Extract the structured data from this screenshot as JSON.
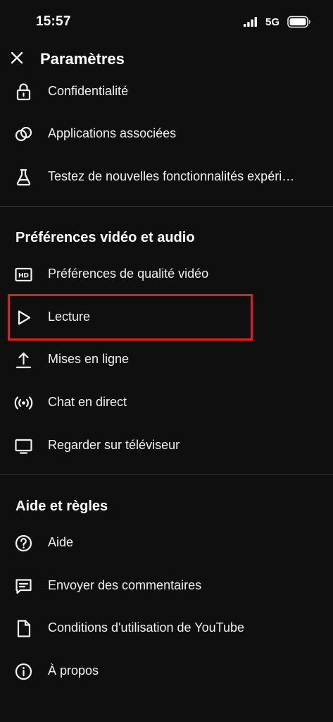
{
  "status_bar": {
    "time": "15:57",
    "network": "5G"
  },
  "header": {
    "title": "Paramètres"
  },
  "top_items": [
    {
      "label": "Confidentialité",
      "icon": "lock-icon"
    },
    {
      "label": "Applications associées",
      "icon": "linked-circles-icon"
    },
    {
      "label": "Testez de nouvelles fonctionnalités expéri…",
      "icon": "flask-icon"
    }
  ],
  "video_audio": {
    "title": "Préférences vidéo et audio",
    "items": [
      {
        "label": "Préférences de qualité vidéo",
        "icon": "hd-icon"
      },
      {
        "label": "Lecture",
        "icon": "play-icon"
      },
      {
        "label": "Mises en ligne",
        "icon": "upload-icon"
      },
      {
        "label": "Chat en direct",
        "icon": "live-broadcast-icon"
      },
      {
        "label": "Regarder sur téléviseur",
        "icon": "tv-icon"
      }
    ]
  },
  "help": {
    "title": "Aide et règles",
    "items": [
      {
        "label": "Aide",
        "icon": "help-circle-icon"
      },
      {
        "label": "Envoyer des commentaires",
        "icon": "feedback-icon"
      },
      {
        "label": "Conditions d'utilisation de YouTube",
        "icon": "document-icon"
      },
      {
        "label": "À propos",
        "icon": "info-icon"
      }
    ]
  },
  "colors": {
    "background": "#0f0f0f",
    "text": "#f1f1f1",
    "divider": "#3a3a3a",
    "highlight": "#e01e1e"
  }
}
